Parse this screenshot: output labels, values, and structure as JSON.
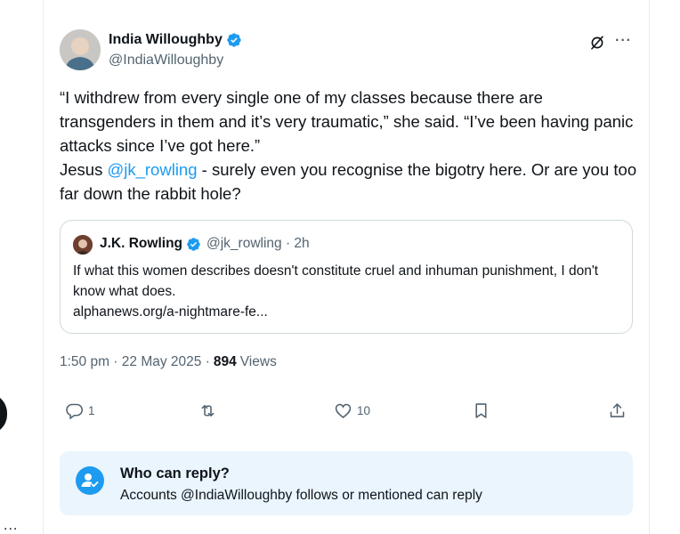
{
  "tweet": {
    "author_name": "India Willoughby",
    "author_handle": "@IndiaWilloughby",
    "body_line1": "“I withdrew from every single one of my classes because there are transgenders in them and it’s very traumatic,” she said. “I’ve been having panic attacks since I’ve got here.”",
    "body_prefix": "Jesus ",
    "body_mention": "@jk_rowling",
    "body_suffix": " - surely even you recognise the bigotry here. Or are you too far down the rabbit hole?",
    "timestamp": "1:50 pm · 22 May 2025 · ",
    "views_count": "894",
    "views_label": "Views"
  },
  "quoted_tweet": {
    "author_name": "J.K. Rowling",
    "author_handle": "@jk_rowling · 2h",
    "text": "If what this women describes doesn't constitute cruel and inhuman punishment, I don't know what does.",
    "link": "alphanews.org/a-nightmare-fe..."
  },
  "actions": {
    "replies": "1",
    "likes": "10"
  },
  "reply_restriction": {
    "title": "Who can reply?",
    "subtitle": "Accounts @IndiaWilloughby follows or mentioned can reply"
  },
  "edge": {
    "ellipsis": "..."
  },
  "colors": {
    "accent": "#1d9bf0",
    "text": "#0f1419",
    "muted": "#536471",
    "reply_bg": "#eaf5fd"
  }
}
